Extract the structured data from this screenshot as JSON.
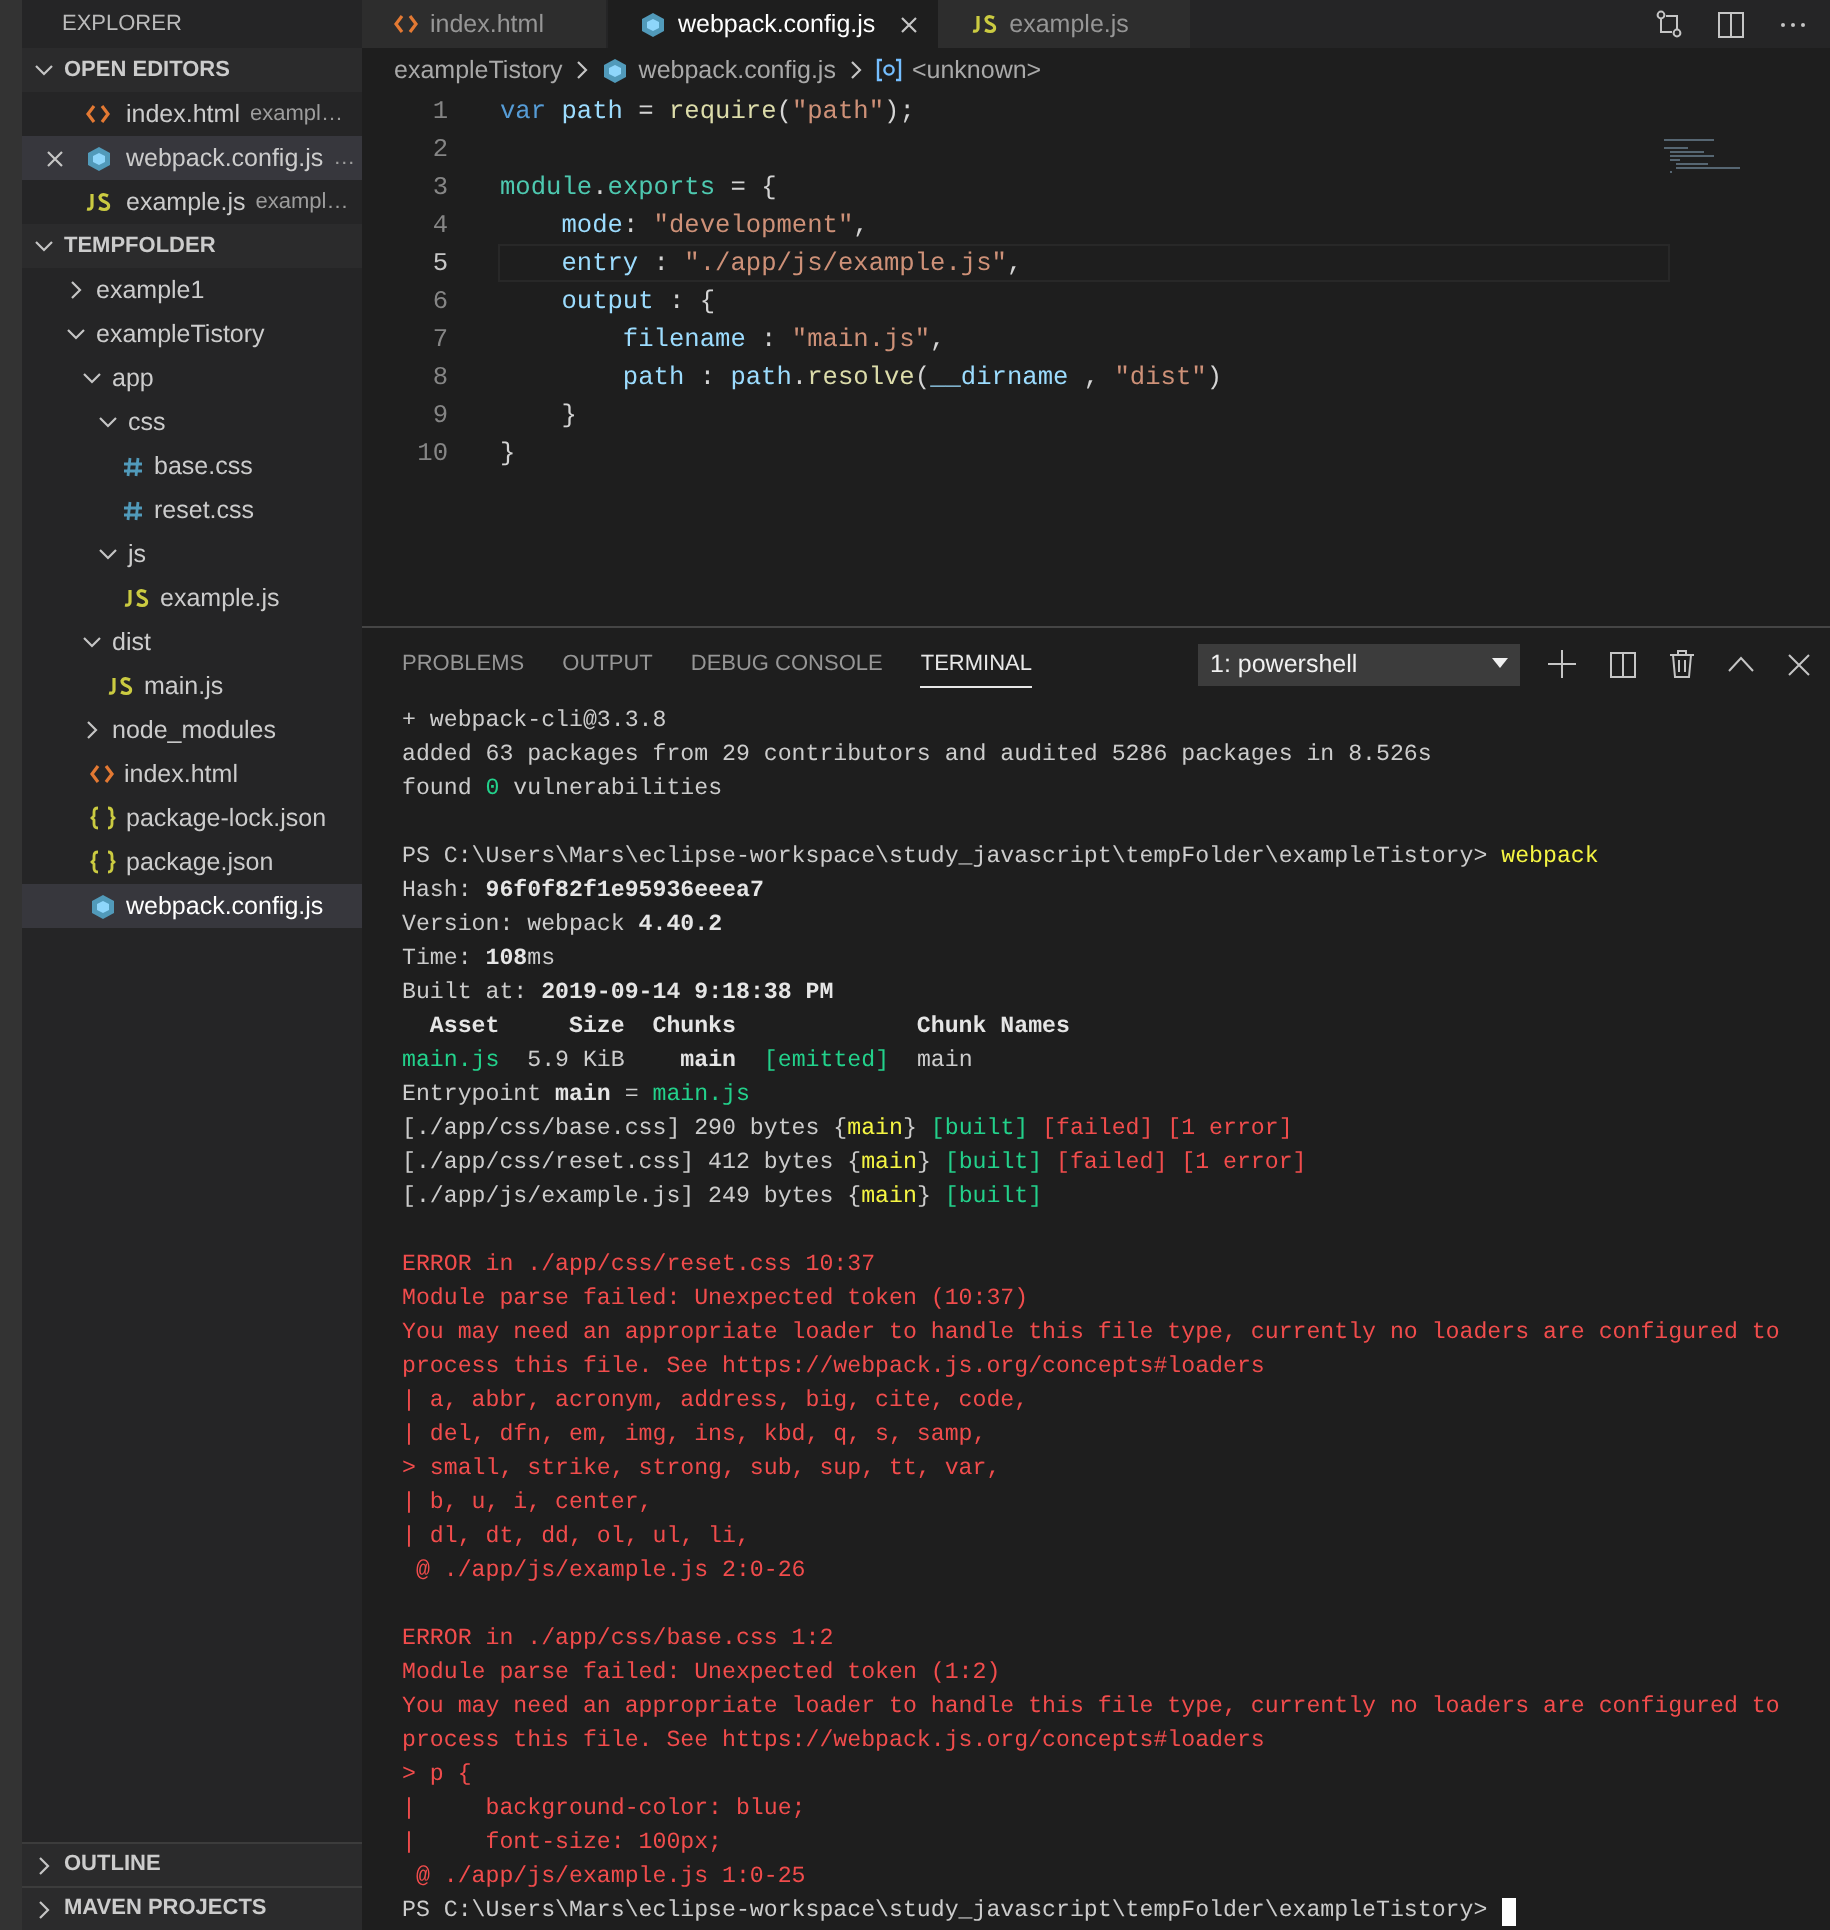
{
  "sidebar": {
    "title": "EXPLORER",
    "open_editors": {
      "title": "OPEN EDITORS",
      "expanded": true,
      "items": [
        {
          "label": "index.html",
          "description": "exampl…",
          "kind": "html",
          "selected": false
        },
        {
          "label": "webpack.config.js",
          "description": "…",
          "kind": "webpack",
          "selected": true
        },
        {
          "label": "example.js",
          "description": "exampl…",
          "kind": "js",
          "selected": false
        }
      ]
    },
    "folder": {
      "title": "TEMPFOLDER",
      "expanded": true,
      "items": [
        {
          "label": "example1",
          "kind": "folder",
          "expanded": false,
          "selected": false
        },
        {
          "label": "exampleTistory",
          "kind": "folder",
          "expanded": true,
          "selected": false,
          "children": [
            {
              "label": "app",
              "kind": "folder",
              "expanded": true,
              "selected": false,
              "children": [
                {
                  "label": "css",
                  "kind": "folder",
                  "expanded": true,
                  "selected": false,
                  "children": [
                    {
                      "label": "base.css",
                      "kind": "css",
                      "selected": false
                    },
                    {
                      "label": "reset.css",
                      "kind": "css",
                      "selected": false
                    }
                  ]
                },
                {
                  "label": "js",
                  "kind": "folder",
                  "expanded": true,
                  "selected": false,
                  "children": [
                    {
                      "label": "example.js",
                      "kind": "js",
                      "selected": false
                    }
                  ]
                }
              ]
            },
            {
              "label": "dist",
              "kind": "folder",
              "expanded": true,
              "selected": false,
              "children": [
                {
                  "label": "main.js",
                  "kind": "js",
                  "selected": false
                }
              ]
            },
            {
              "label": "node_modules",
              "kind": "folder",
              "expanded": false,
              "selected": false
            },
            {
              "label": "index.html",
              "kind": "html",
              "selected": false
            },
            {
              "label": "package-lock.json",
              "kind": "json",
              "selected": false
            },
            {
              "label": "package.json",
              "kind": "json",
              "selected": false
            },
            {
              "label": "webpack.config.js",
              "kind": "webpack",
              "selected": true
            }
          ]
        }
      ]
    },
    "bottom_sections": [
      {
        "title": "OUTLINE",
        "expanded": false
      },
      {
        "title": "MAVEN PROJECTS",
        "expanded": false
      }
    ]
  },
  "tabs": [
    {
      "label": "index.html",
      "kind": "html",
      "selected": false
    },
    {
      "label": "webpack.config.js",
      "kind": "webpack",
      "selected": true
    },
    {
      "label": "example.js",
      "kind": "js",
      "selected": false
    }
  ],
  "breadcrumb": [
    {
      "label": "exampleTistory",
      "kind": "folder"
    },
    {
      "label": "webpack.config.js",
      "kind": "webpack"
    },
    {
      "label": "<unknown>",
      "kind": "symbol"
    }
  ],
  "code": [
    {
      "number": "1",
      "current": false,
      "tokens": [
        {
          "text": "var",
          "kind": "keyword"
        },
        {
          "text": " path",
          "kind": "variable"
        },
        {
          "text": " = ",
          "kind": "plain"
        },
        {
          "text": "require",
          "kind": "function"
        },
        {
          "text": "(",
          "kind": "plain"
        },
        {
          "text": "\"path\"",
          "kind": "string"
        },
        {
          "text": ");",
          "kind": "plain"
        }
      ]
    },
    {
      "number": "2",
      "current": false
    },
    {
      "number": "3",
      "current": false,
      "tokens": [
        {
          "text": "module",
          "kind": "type"
        },
        {
          "text": ".",
          "kind": "plain"
        },
        {
          "text": "exports",
          "kind": "type"
        },
        {
          "text": " = {",
          "kind": "plain"
        }
      ]
    },
    {
      "number": "4",
      "current": false,
      "tokens": [
        {
          "text": "    mode",
          "kind": "variable"
        },
        {
          "text": ": ",
          "kind": "plain"
        },
        {
          "text": "\"development\"",
          "kind": "string"
        },
        {
          "text": ",",
          "kind": "plain"
        }
      ]
    },
    {
      "number": "5",
      "current": true,
      "tokens": [
        {
          "text": "    entry",
          "kind": "variable"
        },
        {
          "text": " : ",
          "kind": "plain"
        },
        {
          "text": "\"./app/js/example.js\"",
          "kind": "string"
        },
        {
          "text": ",",
          "kind": "plain"
        }
      ]
    },
    {
      "number": "6",
      "current": false,
      "tokens": [
        {
          "text": "    output",
          "kind": "variable"
        },
        {
          "text": " : {",
          "kind": "plain"
        }
      ]
    },
    {
      "number": "7",
      "current": false,
      "tokens": [
        {
          "text": "        filename",
          "kind": "variable"
        },
        {
          "text": " : ",
          "kind": "plain"
        },
        {
          "text": "\"main.js\"",
          "kind": "string"
        },
        {
          "text": ",",
          "kind": "plain"
        }
      ]
    },
    {
      "number": "8",
      "current": false,
      "tokens": [
        {
          "text": "        path",
          "kind": "variable"
        },
        {
          "text": " : ",
          "kind": "plain"
        },
        {
          "text": "path",
          "kind": "variable"
        },
        {
          "text": ".",
          "kind": "plain"
        },
        {
          "text": "resolve",
          "kind": "function"
        },
        {
          "text": "(",
          "kind": "plain"
        },
        {
          "text": "__dirname",
          "kind": "variable"
        },
        {
          "text": " , ",
          "kind": "plain"
        },
        {
          "text": "\"dist\"",
          "kind": "string"
        },
        {
          "text": ")",
          "kind": "plain"
        }
      ]
    },
    {
      "number": "9",
      "current": false,
      "tokens": [
        {
          "text": "    }",
          "kind": "plain"
        }
      ]
    },
    {
      "number": "10",
      "current": false,
      "tokens": [
        {
          "text": "}",
          "kind": "plain"
        }
      ]
    }
  ],
  "panel": {
    "tabs": [
      {
        "label": "PROBLEMS",
        "selected": false
      },
      {
        "label": "OUTPUT",
        "selected": false
      },
      {
        "label": "DEBUG CONSOLE",
        "selected": false
      },
      {
        "label": "TERMINAL",
        "selected": true
      }
    ],
    "terminal_select": "1: powershell",
    "terminal": [
      [
        [
          {
            "text": "+ webpack-cli@3.3.8",
            "kind": "plain"
          }
        ],
        [
          {
            "text": "added 63 packages from 29 contributors and audited 5286 packages in 8.526s",
            "kind": "plain"
          }
        ],
        [
          {
            "text": "found ",
            "kind": "plain"
          },
          {
            "text": "0",
            "kind": "success"
          },
          {
            "text": " vulnerabilities",
            "kind": "plain"
          }
        ]
      ],
      [
        [
          {
            "text": "PS C:\\Users\\Mars\\eclipse-workspace\\study_javascript\\tempFolder\\exampleTistory> ",
            "kind": "plain"
          },
          {
            "text": "webpack",
            "kind": "command"
          }
        ],
        [
          {
            "text": "Hash: ",
            "kind": "plain"
          },
          {
            "text": "96f0f82f1e95936eeea7",
            "kind": "bold"
          }
        ],
        [
          {
            "text": "Version: webpack ",
            "kind": "plain"
          },
          {
            "text": "4.40.2",
            "kind": "bold"
          }
        ],
        [
          {
            "text": "Time: ",
            "kind": "plain"
          },
          {
            "text": "108",
            "kind": "bold"
          },
          {
            "text": "ms",
            "kind": "plain"
          }
        ],
        [
          {
            "text": "Built at: ",
            "kind": "plain"
          },
          {
            "text": "2019-09-14 9:18:38 PM",
            "kind": "bold"
          }
        ],
        [
          {
            "text": "  Asset     Size  Chunks             Chunk Names",
            "kind": "bold"
          }
        ],
        [
          {
            "text": "main.js",
            "kind": "success"
          },
          {
            "text": "  5.9 KiB    ",
            "kind": "plain"
          },
          {
            "text": "main",
            "kind": "bold"
          },
          {
            "text": "  [emitted]",
            "kind": "success"
          },
          {
            "text": "  main",
            "kind": "plain"
          }
        ],
        [
          {
            "text": "Entrypoint ",
            "kind": "plain"
          },
          {
            "text": "main",
            "kind": "bold"
          },
          {
            "text": " = ",
            "kind": "plain"
          },
          {
            "text": "main.js",
            "kind": "success"
          }
        ],
        [
          {
            "text": "[./app/css/base.css] 290 bytes {",
            "kind": "plain"
          },
          {
            "text": "main",
            "kind": "command"
          },
          {
            "text": "} ",
            "kind": "plain"
          },
          {
            "text": "[built]",
            "kind": "success"
          },
          {
            "text": " [failed] [1 error]",
            "kind": "error"
          }
        ],
        [
          {
            "text": "[./app/css/reset.css] 412 bytes {",
            "kind": "plain"
          },
          {
            "text": "main",
            "kind": "command"
          },
          {
            "text": "} ",
            "kind": "plain"
          },
          {
            "text": "[built]",
            "kind": "success"
          },
          {
            "text": " [failed] [1 error]",
            "kind": "error"
          }
        ],
        [
          {
            "text": "[./app/js/example.js] 249 bytes {",
            "kind": "plain"
          },
          {
            "text": "main",
            "kind": "command"
          },
          {
            "text": "} ",
            "kind": "plain"
          },
          {
            "text": "[built]",
            "kind": "success"
          }
        ]
      ],
      [
        [
          {
            "text": "ERROR in ./app/css/reset.css 10:37",
            "kind": "error"
          }
        ],
        [
          {
            "text": "Module parse failed: Unexpected token (10:37)",
            "kind": "error"
          }
        ],
        [
          {
            "text": "You may need an appropriate loader to handle this file type, currently no loaders are configured to",
            "kind": "error"
          }
        ],
        [
          {
            "text": "process this file. See https://webpack.js.org/concepts#loaders",
            "kind": "error"
          }
        ],
        [
          {
            "text": "| a, abbr, acronym, address, big, cite, code,",
            "kind": "error"
          }
        ],
        [
          {
            "text": "| del, dfn, em, img, ins, kbd, q, s, samp,",
            "kind": "error"
          }
        ],
        [
          {
            "text": "> small, strike, strong, sub, sup, tt, var,",
            "kind": "error"
          }
        ],
        [
          {
            "text": "| b, u, i, center,",
            "kind": "error"
          }
        ],
        [
          {
            "text": "| dl, dt, dd, ol, ul, li,",
            "kind": "error"
          }
        ],
        [
          {
            "text": " @ ./app/js/example.js 2:0-26",
            "kind": "error"
          }
        ]
      ],
      [
        [
          {
            "text": "ERROR in ./app/css/base.css 1:2",
            "kind": "error"
          }
        ],
        [
          {
            "text": "Module parse failed: Unexpected token (1:2)",
            "kind": "error"
          }
        ],
        [
          {
            "text": "You may need an appropriate loader to handle this file type, currently no loaders are configured to",
            "kind": "error"
          }
        ],
        [
          {
            "text": "process this file. See https://webpack.js.org/concepts#loaders",
            "kind": "error"
          }
        ],
        [
          {
            "text": "> p {",
            "kind": "error"
          }
        ],
        [
          {
            "text": "|     background-color: blue;",
            "kind": "error"
          }
        ],
        [
          {
            "text": "|     font-size: 100px;",
            "kind": "error"
          }
        ],
        [
          {
            "text": " @ ./app/js/example.js 1:0-25",
            "kind": "error"
          }
        ],
        [
          {
            "text": "PS C:\\Users\\Mars\\eclipse-workspace\\study_javascript\\tempFolder\\exampleTistory> ",
            "kind": "plain"
          }
        ]
      ]
    ]
  }
}
